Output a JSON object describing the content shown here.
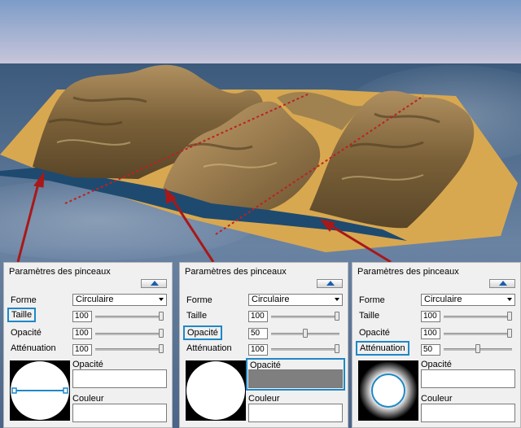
{
  "colors": {
    "accent": "#1e88c8",
    "arrow": "#a81818",
    "terrain": "#d8a850",
    "water": "#3a5878"
  },
  "panels": [
    {
      "title": "Paramètres des pinceaux",
      "forme_label": "Forme",
      "forme_value": "Circulaire",
      "taille_label": "Taille",
      "taille_value": "100",
      "taille_level": 1.0,
      "opacite_label": "Opacité",
      "opacite_value": "100",
      "opacite_level": 1.0,
      "attenuation_label": "Atténuation",
      "attenuation_value": "100",
      "attenuation_level": 1.0,
      "field_opacite_label": "Opacité",
      "field_couleur_label": "Couleur",
      "highlight": "taille"
    },
    {
      "title": "Paramètres des pinceaux",
      "forme_label": "Forme",
      "forme_value": "Circulaire",
      "taille_label": "Taille",
      "taille_value": "100",
      "taille_level": 1.0,
      "opacite_label": "Opacité",
      "opacite_value": "50",
      "opacite_level": 0.5,
      "attenuation_label": "Atténuation",
      "attenuation_value": "100",
      "attenuation_level": 1.0,
      "field_opacite_label": "Opacité",
      "field_couleur_label": "Couleur",
      "highlight": "opacite"
    },
    {
      "title": "Paramètres des pinceaux",
      "forme_label": "Forme",
      "forme_value": "Circulaire",
      "taille_label": "Taille",
      "taille_value": "100",
      "taille_level": 1.0,
      "opacite_label": "Opacité",
      "opacite_value": "100",
      "opacite_level": 1.0,
      "attenuation_label": "Atténuation",
      "attenuation_value": "50",
      "attenuation_level": 0.5,
      "field_opacite_label": "Opacité",
      "field_couleur_label": "Couleur",
      "highlight": "attenuation"
    }
  ]
}
